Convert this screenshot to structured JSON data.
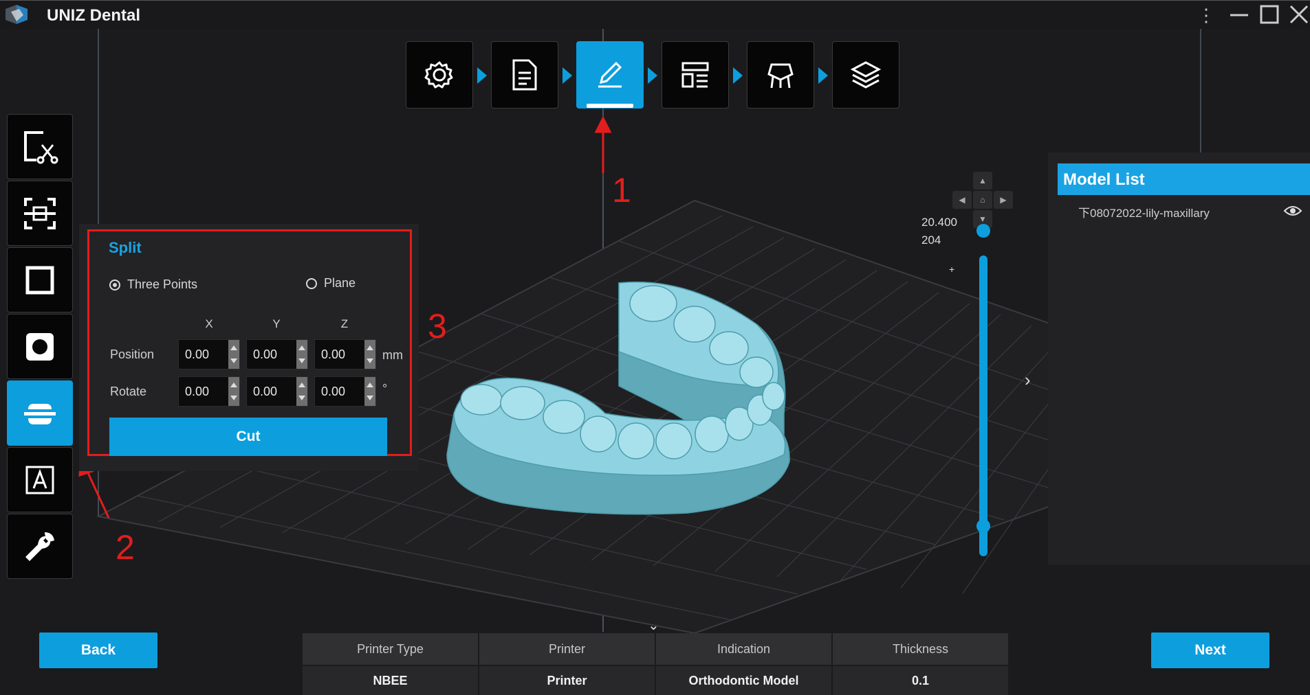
{
  "app": {
    "title": "UNIZ Dental"
  },
  "split_panel": {
    "title": "Split",
    "mode_three_points": "Three Points",
    "mode_plane": "Plane",
    "col_x": "X",
    "col_y": "Y",
    "col_z": "Z",
    "position_label": "Position",
    "rotate_label": "Rotate",
    "position": {
      "x": "0.00",
      "y": "0.00",
      "z": "0.00"
    },
    "rotate": {
      "x": "0.00",
      "y": "0.00",
      "z": "0.00"
    },
    "position_unit": "mm",
    "rotate_unit": "°",
    "cut_label": "Cut"
  },
  "model_list": {
    "header": "Model List",
    "items": [
      "下08072022-lily-maxillary"
    ]
  },
  "slider": {
    "top_value": "20.400",
    "top_layer": "204"
  },
  "footer": {
    "back_label": "Back",
    "next_label": "Next",
    "headers": [
      "Printer Type",
      "Printer",
      "Indication",
      "Thickness"
    ],
    "values": [
      "NBEE",
      "Printer",
      "Orthodontic Model",
      "0.1"
    ]
  },
  "annotations": {
    "a1": "1",
    "a2": "2",
    "a3": "3"
  },
  "workflow_steps": [
    "gear-icon",
    "document-icon",
    "edit-icon",
    "layout-icon",
    "support-icon",
    "layers-icon"
  ],
  "active_step": "edit",
  "tools": [
    "cut-scissors-icon",
    "scan-bracket-icon",
    "square-icon",
    "circle-fill-icon",
    "split-icon",
    "text-label-icon",
    "wrench-icon"
  ],
  "active_tool": "split",
  "colors": {
    "accent": "#0d9ede",
    "annotation": "#e31d1d",
    "model": "#7cc6d6"
  }
}
